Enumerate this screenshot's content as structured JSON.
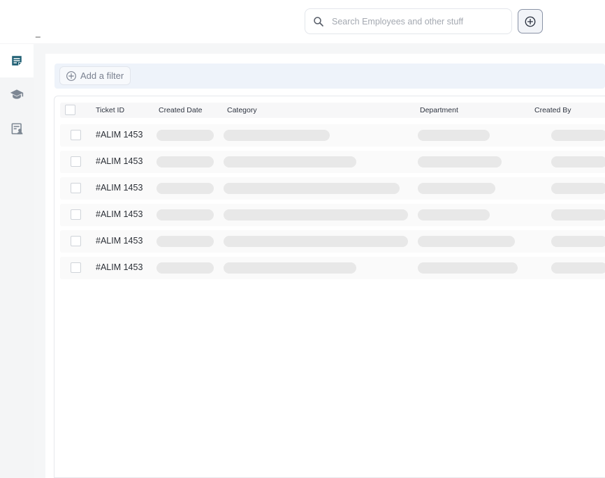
{
  "header": {
    "dash_mark": "_",
    "search": {
      "placeholder": "Search Employees and other stuff",
      "value": ""
    }
  },
  "sidebar": {
    "items": [
      {
        "icon": "notes-icon",
        "active": true
      },
      {
        "icon": "graduation-cap-icon",
        "active": false
      },
      {
        "icon": "report-icon",
        "active": false
      }
    ]
  },
  "filter": {
    "label": "Add a filter"
  },
  "table": {
    "columns": [
      "Ticket ID",
      "Created Date",
      "Category",
      "Department",
      "Created By"
    ],
    "rows": [
      {
        "ticket_id": "#ALIM 1453"
      },
      {
        "ticket_id": "#ALIM 1453"
      },
      {
        "ticket_id": "#ALIM 1453"
      },
      {
        "ticket_id": "#ALIM 1453"
      },
      {
        "ticket_id": "#ALIM 1453"
      },
      {
        "ticket_id": "#ALIM 1453"
      }
    ]
  },
  "colors": {
    "accent": "#1f5f73",
    "sidebar_bg": "#f4f5f6",
    "filter_bar_bg": "#eef3fa",
    "skeleton": "#e8e8e8"
  }
}
